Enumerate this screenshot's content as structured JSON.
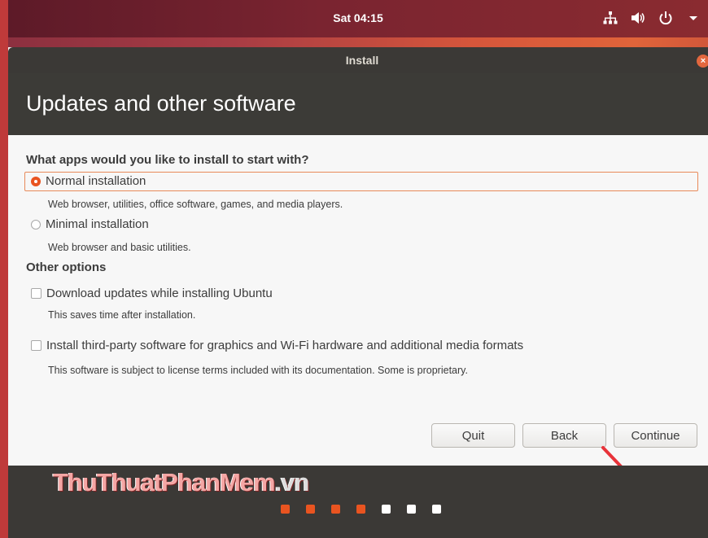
{
  "topbar": {
    "clock": "Sat 04:15",
    "icons": [
      "network-icon",
      "volume-icon",
      "power-icon",
      "menu-arrow-icon"
    ]
  },
  "window": {
    "title": "Install",
    "close_icon": "close-icon",
    "heading": "Updates and other software"
  },
  "content": {
    "question": "What apps would you like to install to start with?",
    "options": [
      {
        "label": "Normal installation",
        "description": "Web browser, utilities, office software, games, and media players.",
        "selected": true
      },
      {
        "label": "Minimal installation",
        "description": "Web browser and basic utilities.",
        "selected": false
      }
    ],
    "other_heading": "Other options",
    "checks": [
      {
        "label": "Download updates while installing Ubuntu",
        "description": "This saves time after installation.",
        "checked": false
      },
      {
        "label": "Install third-party software for graphics and Wi-Fi hardware and additional media formats",
        "description": "This software is subject to license terms included with its documentation. Some is proprietary.",
        "checked": false
      }
    ]
  },
  "buttons": {
    "quit": "Quit",
    "back": "Back",
    "continue": "Continue"
  },
  "progress": {
    "steps_total": 7,
    "steps_done": 4,
    "active_color": "#e95420",
    "inactive_color": "#ffffff"
  },
  "watermark": {
    "main": "ThuThuatPhanMem",
    "suffix": ".vn"
  },
  "colors": {
    "accent": "#e95420",
    "annotation_arrow": "#e8333a"
  }
}
